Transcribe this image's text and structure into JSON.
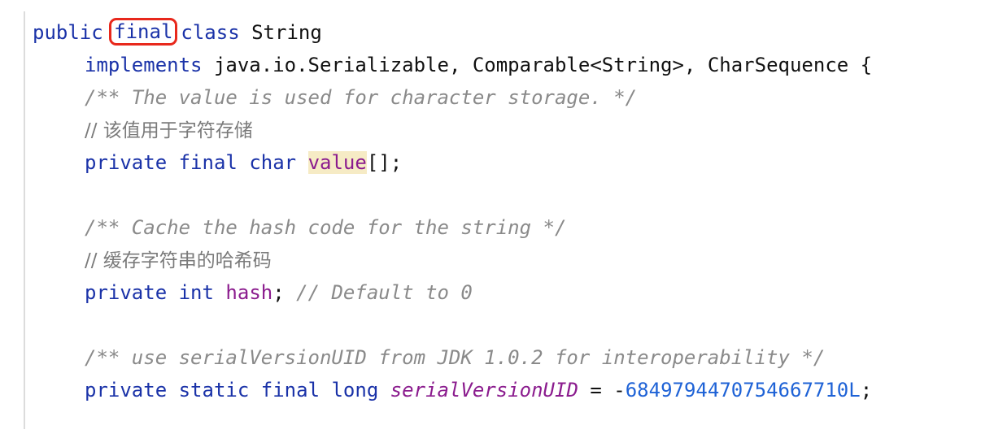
{
  "code": {
    "line1": {
      "public": "public",
      "final": "final",
      "class": "class",
      "name": "String"
    },
    "line2": {
      "implements": "implements",
      "rest": "java.io.Serializable, Comparable<String>, CharSequence {"
    },
    "line3": {
      "comment": "/** The value is used for character storage. */"
    },
    "line4": {
      "comment": "// 该值用于字符存储"
    },
    "line5": {
      "private": "private",
      "final": "final",
      "type": "char",
      "field": "value",
      "rest": "[];"
    },
    "line7": {
      "comment": "/** Cache the hash code for the string */"
    },
    "line8": {
      "comment": "// 缓存字符串的哈希码"
    },
    "line9": {
      "private": "private",
      "type": "int",
      "field": "hash",
      "semi": ";",
      "comment": "// Default to 0"
    },
    "line11": {
      "comment": "/** use serialVersionUID from JDK 1.0.2 for interoperability */"
    },
    "line12": {
      "private": "private",
      "static": "static",
      "final": "final",
      "type": "long",
      "field": "serialVersionUID",
      "eq": "=",
      "minus": "-",
      "number": "6849794470754667710L",
      "semi": ";"
    }
  },
  "colors": {
    "keyword": "#1a32a8",
    "comment": "#8a8a8a",
    "field": "#8b1c8e",
    "number": "#1e62d6",
    "highlight_box": "#e8281c",
    "value_highlight": "#f6ebc5"
  }
}
